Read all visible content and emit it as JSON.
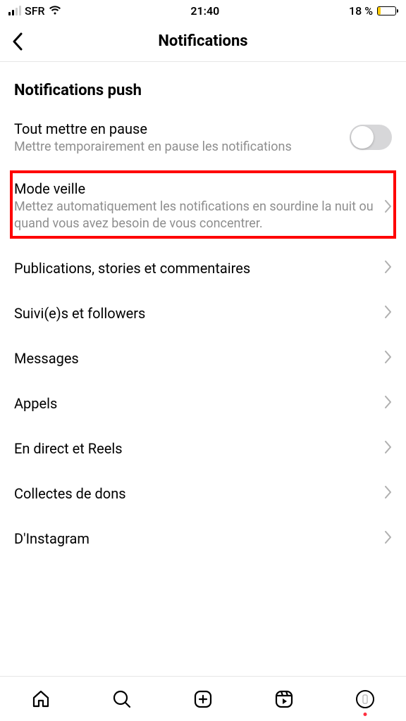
{
  "status_bar": {
    "carrier": "SFR",
    "time": "21:40",
    "battery_pct": "18 %"
  },
  "header": {
    "title": "Notifications"
  },
  "section": {
    "title": "Notifications push"
  },
  "pause_all": {
    "label": "Tout mettre en pause",
    "desc": "Mettre temporairement en pause les notifications"
  },
  "quiet_mode": {
    "label": "Mode veille",
    "desc": "Mettez automatiquement les notifications en sourdine la nuit ou quand vous avez besoin de vous concentrer."
  },
  "links": {
    "posts": "Publications, stories et commentaires",
    "following": "Suivi(e)s et followers",
    "messages": "Messages",
    "calls": "Appels",
    "live": "En direct et Reels",
    "fundraisers": "Collectes de dons",
    "from_ig": "D'Instagram"
  }
}
